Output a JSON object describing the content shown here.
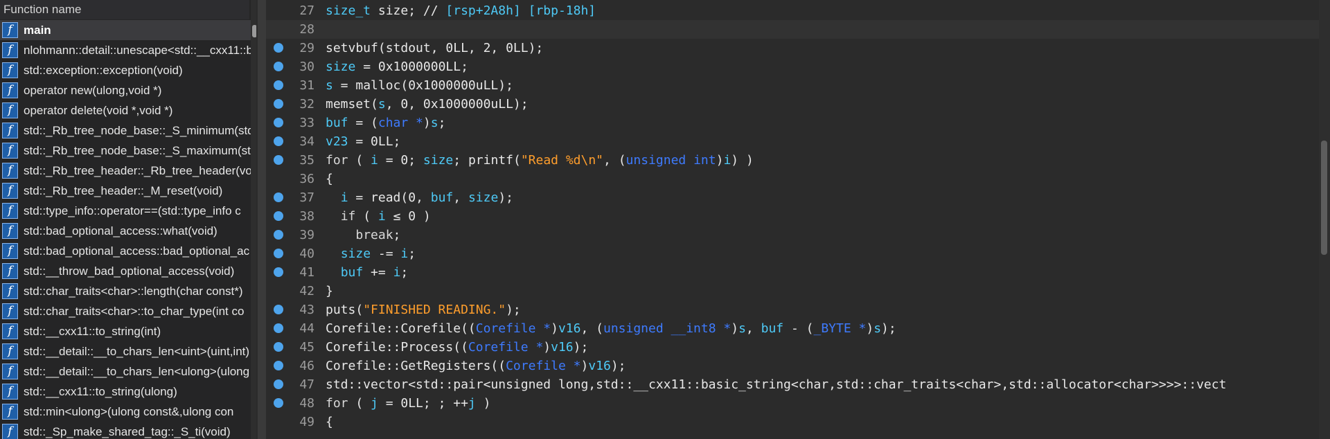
{
  "function_panel": {
    "header": "Function name",
    "icon_glyph": "f",
    "functions": [
      "main",
      "nlohmann::detail::unescape<std::__cxx11::b",
      "std::exception::exception(void)",
      "operator new(ulong,void *)",
      "operator delete(void *,void *)",
      "std::_Rb_tree_node_base::_S_minimum(std",
      "std::_Rb_tree_node_base::_S_maximum(std",
      "std::_Rb_tree_header::_Rb_tree_header(voi",
      "std::_Rb_tree_header::_M_reset(void)",
      "std::type_info::operator==(std::type_info c",
      "std::bad_optional_access::what(void)",
      "std::bad_optional_access::bad_optional_ac",
      "std::__throw_bad_optional_access(void)",
      "std::char_traits<char>::length(char const*)",
      "std::char_traits<char>::to_char_type(int co",
      "std::__cxx11::to_string(int)",
      "std::__detail::__to_chars_len<uint>(uint,int)",
      "std::__detail::__to_chars_len<ulong>(ulong",
      "std::__cxx11::to_string(ulong)",
      "std::min<ulong>(ulong const&,ulong con",
      "std::_Sp_make_shared_tag::_S_ti(void)"
    ],
    "selected_index": 0
  },
  "code": {
    "current_line": 28,
    "lines": [
      {
        "n": "27",
        "bp": false,
        "tokens": [
          [
            "var",
            "size_t"
          ],
          [
            "t",
            " size; // "
          ],
          [
            "var",
            "[rsp+2A8h] [rbp-18h]"
          ]
        ]
      },
      {
        "n": "28",
        "bp": false,
        "tokens": []
      },
      {
        "n": "29",
        "bp": true,
        "tokens": [
          [
            "t",
            "setvbuf(stdout, 0LL, 2, 0LL);"
          ]
        ]
      },
      {
        "n": "30",
        "bp": true,
        "tokens": [
          [
            "var",
            "size"
          ],
          [
            "t",
            " = 0x1000000LL;"
          ]
        ]
      },
      {
        "n": "31",
        "bp": true,
        "tokens": [
          [
            "var",
            "s"
          ],
          [
            "t",
            " = malloc(0x1000000uLL);"
          ]
        ]
      },
      {
        "n": "32",
        "bp": true,
        "tokens": [
          [
            "t",
            "memset("
          ],
          [
            "var",
            "s"
          ],
          [
            "t",
            ", 0, 0x1000000uLL);"
          ]
        ]
      },
      {
        "n": "33",
        "bp": true,
        "tokens": [
          [
            "var",
            "buf"
          ],
          [
            "t",
            " = ("
          ],
          [
            "ty",
            "char *"
          ],
          [
            "t",
            ")"
          ],
          [
            "var",
            "s"
          ],
          [
            "t",
            ";"
          ]
        ]
      },
      {
        "n": "34",
        "bp": true,
        "tokens": [
          [
            "var",
            "v23"
          ],
          [
            "t",
            " = 0LL;"
          ]
        ]
      },
      {
        "n": "35",
        "bp": true,
        "tokens": [
          [
            "kw",
            "for"
          ],
          [
            "t",
            " ( "
          ],
          [
            "var",
            "i"
          ],
          [
            "t",
            " = 0; "
          ],
          [
            "var",
            "size"
          ],
          [
            "t",
            "; printf("
          ],
          [
            "str",
            "\"Read %d\\n\""
          ],
          [
            "t",
            ", ("
          ],
          [
            "ty",
            "unsigned int"
          ],
          [
            "t",
            ")"
          ],
          [
            "var",
            "i"
          ],
          [
            "t",
            ") )"
          ]
        ]
      },
      {
        "n": "36",
        "bp": false,
        "tokens": [
          [
            "t",
            "{"
          ]
        ]
      },
      {
        "n": "37",
        "bp": true,
        "tokens": [
          [
            "t",
            "  "
          ],
          [
            "var",
            "i"
          ],
          [
            "t",
            " = read(0, "
          ],
          [
            "var",
            "buf"
          ],
          [
            "t",
            ", "
          ],
          [
            "var",
            "size"
          ],
          [
            "t",
            ");"
          ]
        ]
      },
      {
        "n": "38",
        "bp": true,
        "tokens": [
          [
            "t",
            "  "
          ],
          [
            "kw",
            "if"
          ],
          [
            "t",
            " ( "
          ],
          [
            "var",
            "i"
          ],
          [
            "t",
            " ≤ 0 )"
          ]
        ]
      },
      {
        "n": "39",
        "bp": true,
        "tokens": [
          [
            "t",
            "    "
          ],
          [
            "kw",
            "break"
          ],
          [
            "t",
            ";"
          ]
        ]
      },
      {
        "n": "40",
        "bp": true,
        "tokens": [
          [
            "t",
            "  "
          ],
          [
            "var",
            "size"
          ],
          [
            "t",
            " -= "
          ],
          [
            "var",
            "i"
          ],
          [
            "t",
            ";"
          ]
        ]
      },
      {
        "n": "41",
        "bp": true,
        "tokens": [
          [
            "t",
            "  "
          ],
          [
            "var",
            "buf"
          ],
          [
            "t",
            " += "
          ],
          [
            "var",
            "i"
          ],
          [
            "t",
            ";"
          ]
        ]
      },
      {
        "n": "42",
        "bp": false,
        "tokens": [
          [
            "t",
            "}"
          ]
        ]
      },
      {
        "n": "43",
        "bp": true,
        "tokens": [
          [
            "t",
            "puts("
          ],
          [
            "str",
            "\"FINISHED READING.\""
          ],
          [
            "t",
            ");"
          ]
        ]
      },
      {
        "n": "44",
        "bp": true,
        "tokens": [
          [
            "t",
            "Corefile::Corefile(("
          ],
          [
            "ty",
            "Corefile *"
          ],
          [
            "t",
            ")"
          ],
          [
            "var",
            "v16"
          ],
          [
            "t",
            ", ("
          ],
          [
            "ty",
            "unsigned __int8 *"
          ],
          [
            "t",
            ")"
          ],
          [
            "var",
            "s"
          ],
          [
            "t",
            ", "
          ],
          [
            "var",
            "buf"
          ],
          [
            "t",
            " - ("
          ],
          [
            "ty",
            "_BYTE *"
          ],
          [
            "t",
            ")"
          ],
          [
            "var",
            "s"
          ],
          [
            "t",
            ");"
          ]
        ]
      },
      {
        "n": "45",
        "bp": true,
        "tokens": [
          [
            "t",
            "Corefile::Process(("
          ],
          [
            "ty",
            "Corefile *"
          ],
          [
            "t",
            ")"
          ],
          [
            "var",
            "v16"
          ],
          [
            "t",
            ");"
          ]
        ]
      },
      {
        "n": "46",
        "bp": true,
        "tokens": [
          [
            "t",
            "Corefile::GetRegisters(("
          ],
          [
            "ty",
            "Corefile *"
          ],
          [
            "t",
            ")"
          ],
          [
            "var",
            "v16"
          ],
          [
            "t",
            ");"
          ]
        ]
      },
      {
        "n": "47",
        "bp": true,
        "tokens": [
          [
            "t",
            "std::vector<std::pair<unsigned long,std::__cxx11::basic_string<char,std::char_traits<char>,std::allocator<char>>>>::vect"
          ]
        ]
      },
      {
        "n": "48",
        "bp": true,
        "tokens": [
          [
            "kw",
            "for"
          ],
          [
            "t",
            " ( "
          ],
          [
            "var",
            "j"
          ],
          [
            "t",
            " = 0LL; ; ++"
          ],
          [
            "var",
            "j"
          ],
          [
            "t",
            " )"
          ]
        ]
      },
      {
        "n": "49",
        "bp": false,
        "tokens": [
          [
            "t",
            "{"
          ]
        ]
      }
    ]
  },
  "colors": {
    "variable": "#4ecaf7",
    "type": "#3e7bff",
    "string": "#ff9e2c",
    "breakpoint": "#4ea4ec",
    "function_icon": "#1f5fa8"
  }
}
